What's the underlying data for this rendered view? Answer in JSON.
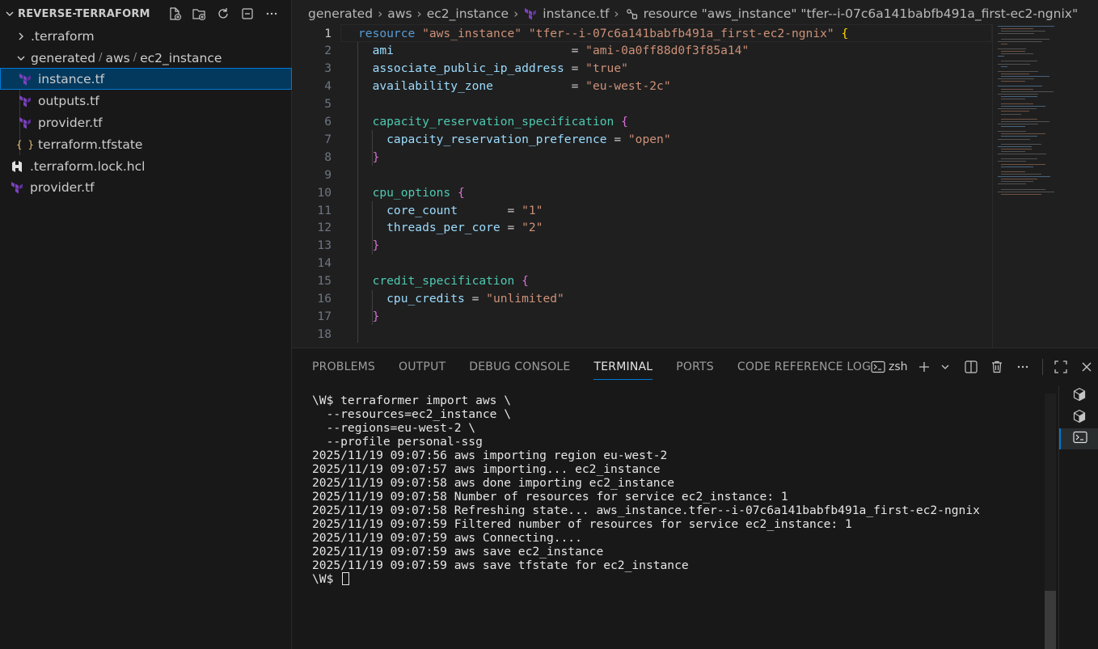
{
  "sidebar": {
    "title": "REVERSE-TERRAFORM",
    "items": [
      {
        "label": ".terraform"
      },
      {
        "label": "generated",
        "path2": "aws",
        "path3": "ec2_instance"
      },
      {
        "label": "instance.tf"
      },
      {
        "label": "outputs.tf"
      },
      {
        "label": "provider.tf"
      },
      {
        "label": "terraform.tfstate"
      },
      {
        "label": ".terraform.lock.hcl"
      },
      {
        "label": "provider.tf"
      }
    ],
    "json_icon_text": "{ }"
  },
  "breadcrumb": [
    "generated",
    "aws",
    "ec2_instance",
    "instance.tf",
    "resource \"aws_instance\" \"tfer--i-07c6a141babfb491a_first-ec2-ngnix\""
  ],
  "editor": {
    "active_line": 1,
    "lines": [
      {
        "n": "1",
        "tokens": [
          [
            "kw",
            "resource "
          ],
          [
            "str",
            "\"aws_instance\" \"tfer--i-07c6a141babfb491a_first-ec2-ngnix\""
          ],
          [
            "plain",
            " "
          ],
          [
            "brace1",
            "{"
          ]
        ]
      },
      {
        "n": "2",
        "tokens": [
          [
            "attr",
            "  ami"
          ],
          [
            "plain",
            "                         = "
          ],
          [
            "str",
            "\"ami-0a0ff88d0f3f85a14\""
          ]
        ]
      },
      {
        "n": "3",
        "tokens": [
          [
            "attr",
            "  associate_public_ip_address"
          ],
          [
            "plain",
            " = "
          ],
          [
            "str",
            "\"true\""
          ]
        ]
      },
      {
        "n": "4",
        "tokens": [
          [
            "attr",
            "  availability_zone"
          ],
          [
            "plain",
            "           = "
          ],
          [
            "str",
            "\"eu-west-2c\""
          ]
        ]
      },
      {
        "n": "5",
        "tokens": []
      },
      {
        "n": "6",
        "tokens": [
          [
            "blk",
            "  capacity_reservation_specification"
          ],
          [
            "plain",
            " "
          ],
          [
            "brace2",
            "{"
          ]
        ]
      },
      {
        "n": "7",
        "tokens": [
          [
            "attr",
            "    capacity_reservation_preference"
          ],
          [
            "plain",
            " = "
          ],
          [
            "str",
            "\"open\""
          ]
        ]
      },
      {
        "n": "8",
        "tokens": [
          [
            "brace2",
            "  }"
          ]
        ]
      },
      {
        "n": "9",
        "tokens": []
      },
      {
        "n": "10",
        "tokens": [
          [
            "blk",
            "  cpu_options"
          ],
          [
            "plain",
            " "
          ],
          [
            "brace2",
            "{"
          ]
        ]
      },
      {
        "n": "11",
        "tokens": [
          [
            "attr",
            "    core_count"
          ],
          [
            "plain",
            "       = "
          ],
          [
            "str",
            "\"1\""
          ]
        ]
      },
      {
        "n": "12",
        "tokens": [
          [
            "attr",
            "    threads_per_core"
          ],
          [
            "plain",
            " = "
          ],
          [
            "str",
            "\"2\""
          ]
        ]
      },
      {
        "n": "13",
        "tokens": [
          [
            "brace2",
            "  }"
          ]
        ]
      },
      {
        "n": "14",
        "tokens": []
      },
      {
        "n": "15",
        "tokens": [
          [
            "blk",
            "  credit_specification"
          ],
          [
            "plain",
            " "
          ],
          [
            "brace2",
            "{"
          ]
        ]
      },
      {
        "n": "16",
        "tokens": [
          [
            "attr",
            "    cpu_credits"
          ],
          [
            "plain",
            " = "
          ],
          [
            "str",
            "\"unlimited\""
          ]
        ]
      },
      {
        "n": "17",
        "tokens": [
          [
            "brace2",
            "  }"
          ]
        ]
      },
      {
        "n": "18",
        "tokens": []
      }
    ]
  },
  "panel": {
    "tabs": [
      "PROBLEMS",
      "OUTPUT",
      "DEBUG CONSOLE",
      "TERMINAL",
      "PORTS",
      "CODE REFERENCE LOG"
    ],
    "active_tab": "TERMINAL",
    "shell_label": "zsh",
    "terminal_lines": [
      "\\W$ terraformer import aws \\",
      "  --resources=ec2_instance \\",
      "  --regions=eu-west-2 \\",
      "  --profile personal-ssg",
      "2025/11/19 09:07:56 aws importing region eu-west-2",
      "2025/11/19 09:07:57 aws importing... ec2_instance",
      "2025/11/19 09:07:58 aws done importing ec2_instance",
      "2025/11/19 09:07:58 Number of resources for service ec2_instance: 1",
      "2025/11/19 09:07:58 Refreshing state... aws_instance.tfer--i-07c6a141babfb491a_first-ec2-ngnix",
      "2025/11/19 09:07:59 Filtered number of resources for service ec2_instance: 1",
      "2025/11/19 09:07:59 aws Connecting....",
      "2025/11/19 09:07:59 aws save ec2_instance",
      "2025/11/19 09:07:59 aws save tfstate for ec2_instance"
    ],
    "prompt": "\\W$ "
  },
  "colors": {
    "accent": "#0078d4",
    "terraform_purple": "#7b42bc",
    "keyword": "#569cd6",
    "string": "#ce9178"
  }
}
